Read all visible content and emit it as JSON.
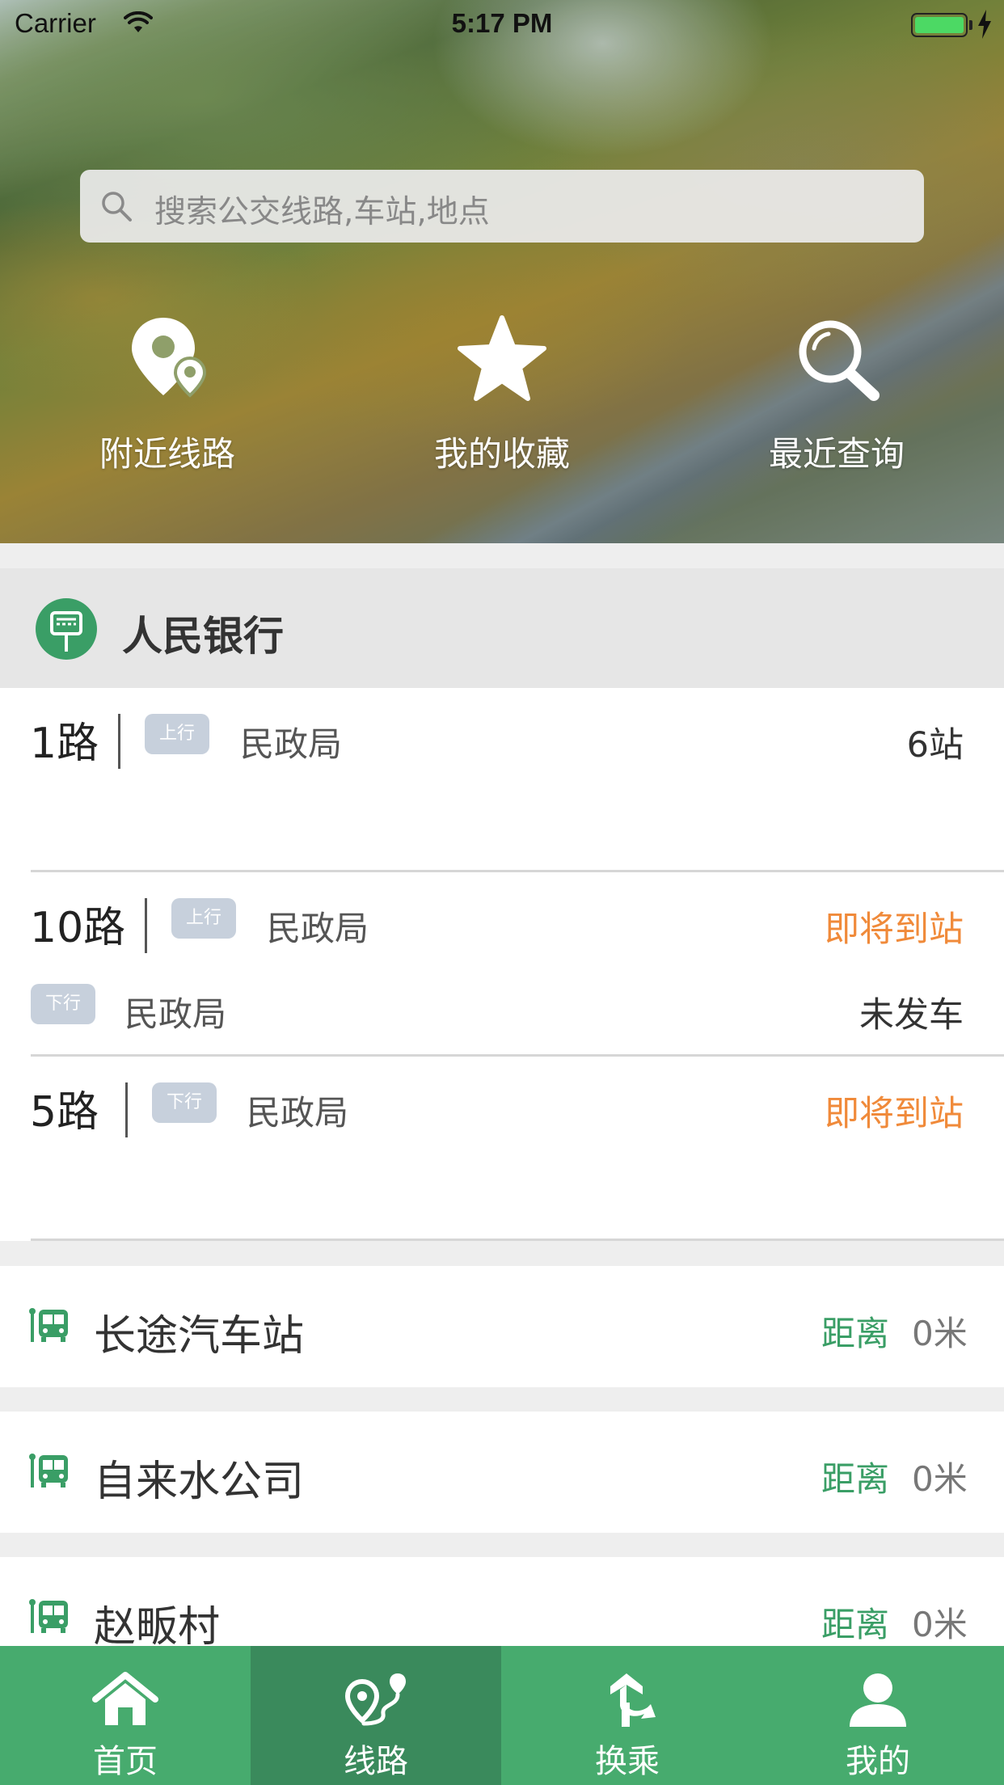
{
  "status_bar": {
    "carrier": "Carrier",
    "time": "5:17 PM"
  },
  "search": {
    "placeholder": "搜索公交线路,车站,地点"
  },
  "quick_actions": [
    {
      "label": "附近线路",
      "icon": "nearby-routes-icon"
    },
    {
      "label": "我的收藏",
      "icon": "star-icon"
    },
    {
      "label": "最近查询",
      "icon": "search-icon"
    }
  ],
  "station": {
    "name": "人民银行",
    "icon": "bus-stop-sign-icon"
  },
  "routes": [
    {
      "name": "1路",
      "lines": [
        {
          "direction": "上行",
          "destination": "民政局",
          "status": "6站",
          "status_type": "count"
        }
      ]
    },
    {
      "name": "10路",
      "lines": [
        {
          "direction": "上行",
          "destination": "民政局",
          "status": "即将到站",
          "status_type": "arriving"
        },
        {
          "direction": "下行",
          "destination": "民政局",
          "status": "未发车",
          "status_type": "not-departed"
        }
      ]
    },
    {
      "name": "5路",
      "lines": [
        {
          "direction": "下行",
          "destination": "民政局",
          "status": "即将到站",
          "status_type": "arriving"
        }
      ]
    }
  ],
  "nearby_stations": [
    {
      "name": "长途汽车站",
      "distance_label": "距离",
      "distance": "0米"
    },
    {
      "name": "自来水公司",
      "distance_label": "距离",
      "distance": "0米"
    },
    {
      "name": "赵畈村",
      "distance_label": "距离",
      "distance": "0米"
    }
  ],
  "tabs": [
    {
      "label": "首页",
      "icon": "home-icon",
      "active": false
    },
    {
      "label": "线路",
      "icon": "route-icon",
      "active": true
    },
    {
      "label": "换乘",
      "icon": "transfer-icon",
      "active": false
    },
    {
      "label": "我的",
      "icon": "user-icon",
      "active": false
    }
  ],
  "colors": {
    "brand_green": "#47ab6e",
    "tab_active": "#3a8a5c",
    "arriving_orange": "#f08a3a",
    "direction_badge": "#c7d0dc"
  }
}
